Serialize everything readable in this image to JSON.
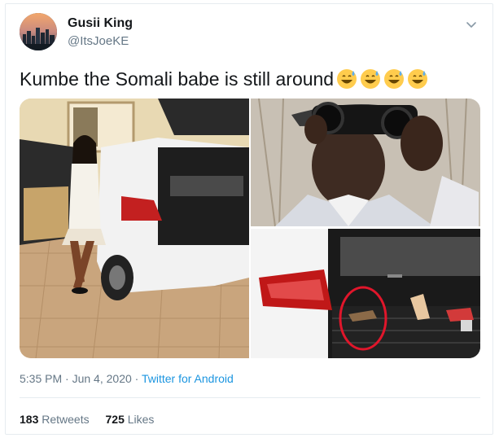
{
  "tweet": {
    "author": {
      "display_name": "Gusii King",
      "handle": "@ItsJoeKE"
    },
    "text": "Kumbe the Somali babe is still around",
    "emoji": [
      "grinning-sweat",
      "grinning-sweat",
      "grinning-sweat",
      "grinning-sweat"
    ],
    "time": "5:35 PM",
    "date": "Jun 4, 2020",
    "separator": "·",
    "source": "Twitter for Android",
    "retweets": {
      "count": "183",
      "label": "Retweets"
    },
    "likes": {
      "count": "725",
      "label": "Likes"
    }
  },
  "icons": {
    "menu": "chevron-down-icon"
  },
  "colors": {
    "text": "#14171a",
    "secondary": "#657786",
    "link": "#1b95e0",
    "divider": "#e6ecf0"
  }
}
